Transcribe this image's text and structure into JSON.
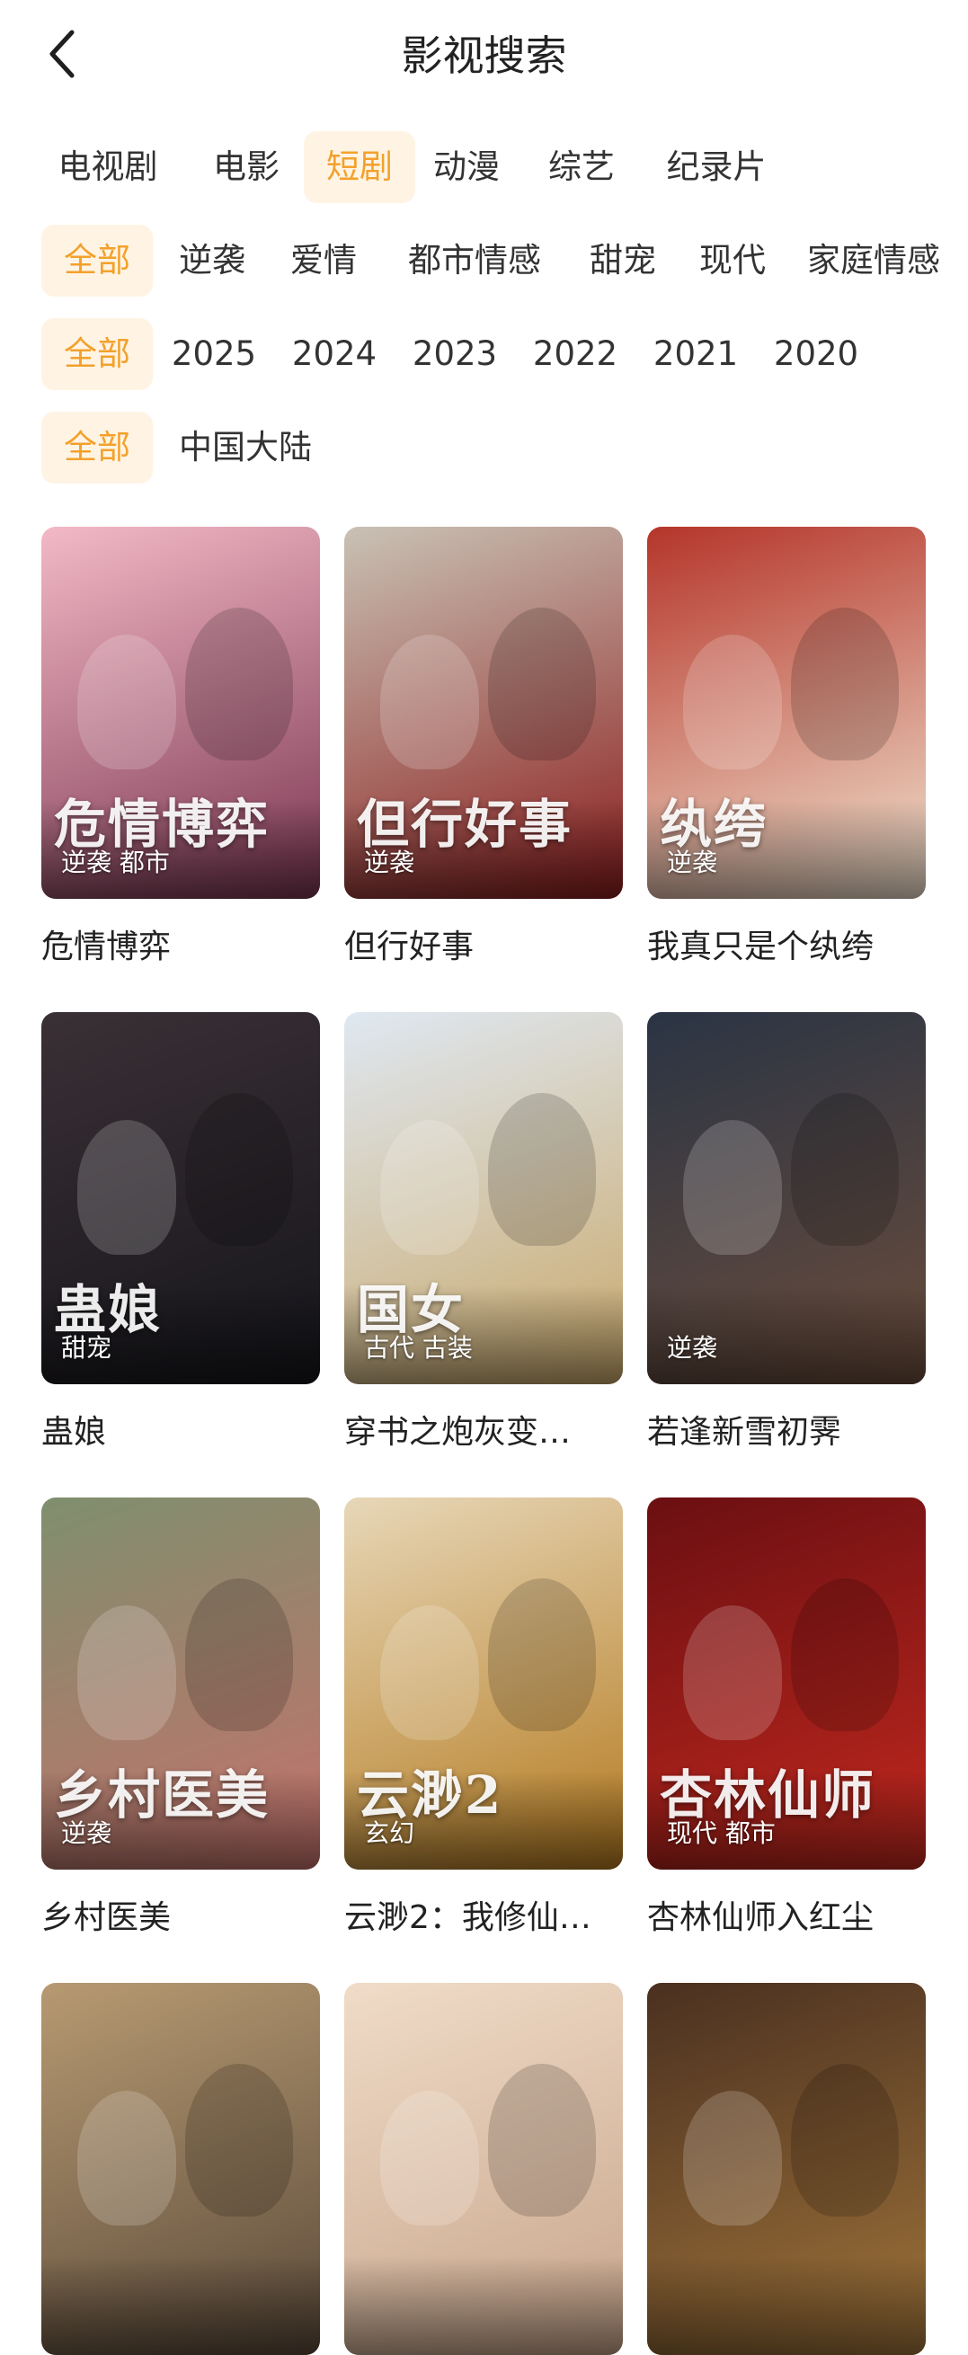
{
  "header": {
    "title": "影视搜索"
  },
  "categories": [
    {
      "label": "电视剧",
      "active": false
    },
    {
      "label": "电影",
      "active": false
    },
    {
      "label": "短剧",
      "active": true
    },
    {
      "label": "动漫",
      "active": false
    },
    {
      "label": "综艺",
      "active": false
    },
    {
      "label": "纪录片",
      "active": false
    }
  ],
  "genres": [
    {
      "label": "全部",
      "active": true
    },
    {
      "label": "逆袭",
      "active": false
    },
    {
      "label": "爱情",
      "active": false
    },
    {
      "label": "都市情感",
      "active": false
    },
    {
      "label": "甜宠",
      "active": false
    },
    {
      "label": "现代",
      "active": false
    },
    {
      "label": "家庭情感",
      "active": false
    }
  ],
  "years": [
    {
      "label": "全部",
      "active": true
    },
    {
      "label": "2025",
      "active": false
    },
    {
      "label": "2024",
      "active": false
    },
    {
      "label": "2023",
      "active": false
    },
    {
      "label": "2022",
      "active": false
    },
    {
      "label": "2021",
      "active": false
    },
    {
      "label": "2020",
      "active": false
    }
  ],
  "regions": [
    {
      "label": "全部",
      "active": true
    },
    {
      "label": "中国大陆",
      "active": false
    }
  ],
  "colors": {
    "accent": "#f3a12b",
    "accent_bg": "#fff4e4"
  },
  "items": [
    {
      "title": "危情博弈",
      "tags": "逆袭 都市",
      "poster_text": "危情博弈",
      "colors": [
        "#f3b9c6",
        "#7a3550"
      ]
    },
    {
      "title": "但行好事",
      "tags": "逆袭",
      "poster_text": "但行好事",
      "colors": [
        "#c9c2b5",
        "#8b1d1d"
      ]
    },
    {
      "title": "我真只是个纨绔",
      "tags": "逆袭",
      "poster_text": "纨绔",
      "colors": [
        "#b5352a",
        "#f1e3cf"
      ]
    },
    {
      "title": "蛊娘",
      "tags": "甜宠",
      "poster_text": "蛊娘",
      "colors": [
        "#3a3036",
        "#15151a"
      ]
    },
    {
      "title": "穿书之炮灰变…",
      "tags": "古代 古装",
      "poster_text": "国女",
      "colors": [
        "#dfe8f2",
        "#c9a86a"
      ]
    },
    {
      "title": "若逢新雪初霁",
      "tags": "逆袭",
      "poster_text": "",
      "colors": [
        "#2a3444",
        "#6b4d3c"
      ]
    },
    {
      "title": "乡村医美",
      "tags": "逆袭",
      "poster_text": "乡村医美",
      "colors": [
        "#7f8f6e",
        "#c4716b"
      ]
    },
    {
      "title": "云渺2：我修仙…",
      "tags": "玄幻",
      "poster_text": "云渺2",
      "colors": [
        "#e7d7b8",
        "#b47a1f"
      ]
    },
    {
      "title": "杏林仙师入红尘",
      "tags": "现代 都市",
      "poster_text": "杏林仙师",
      "colors": [
        "#6b0f12",
        "#c2281e"
      ]
    },
    {
      "title": "",
      "tags": "",
      "poster_text": "",
      "colors": [
        "#b79a72",
        "#5b4a3a"
      ]
    },
    {
      "title": "",
      "tags": "",
      "poster_text": "",
      "colors": [
        "#f0dcc8",
        "#c7a48a"
      ]
    },
    {
      "title": "",
      "tags": "",
      "poster_text": "",
      "colors": [
        "#4a3020",
        "#a0743a"
      ]
    }
  ]
}
